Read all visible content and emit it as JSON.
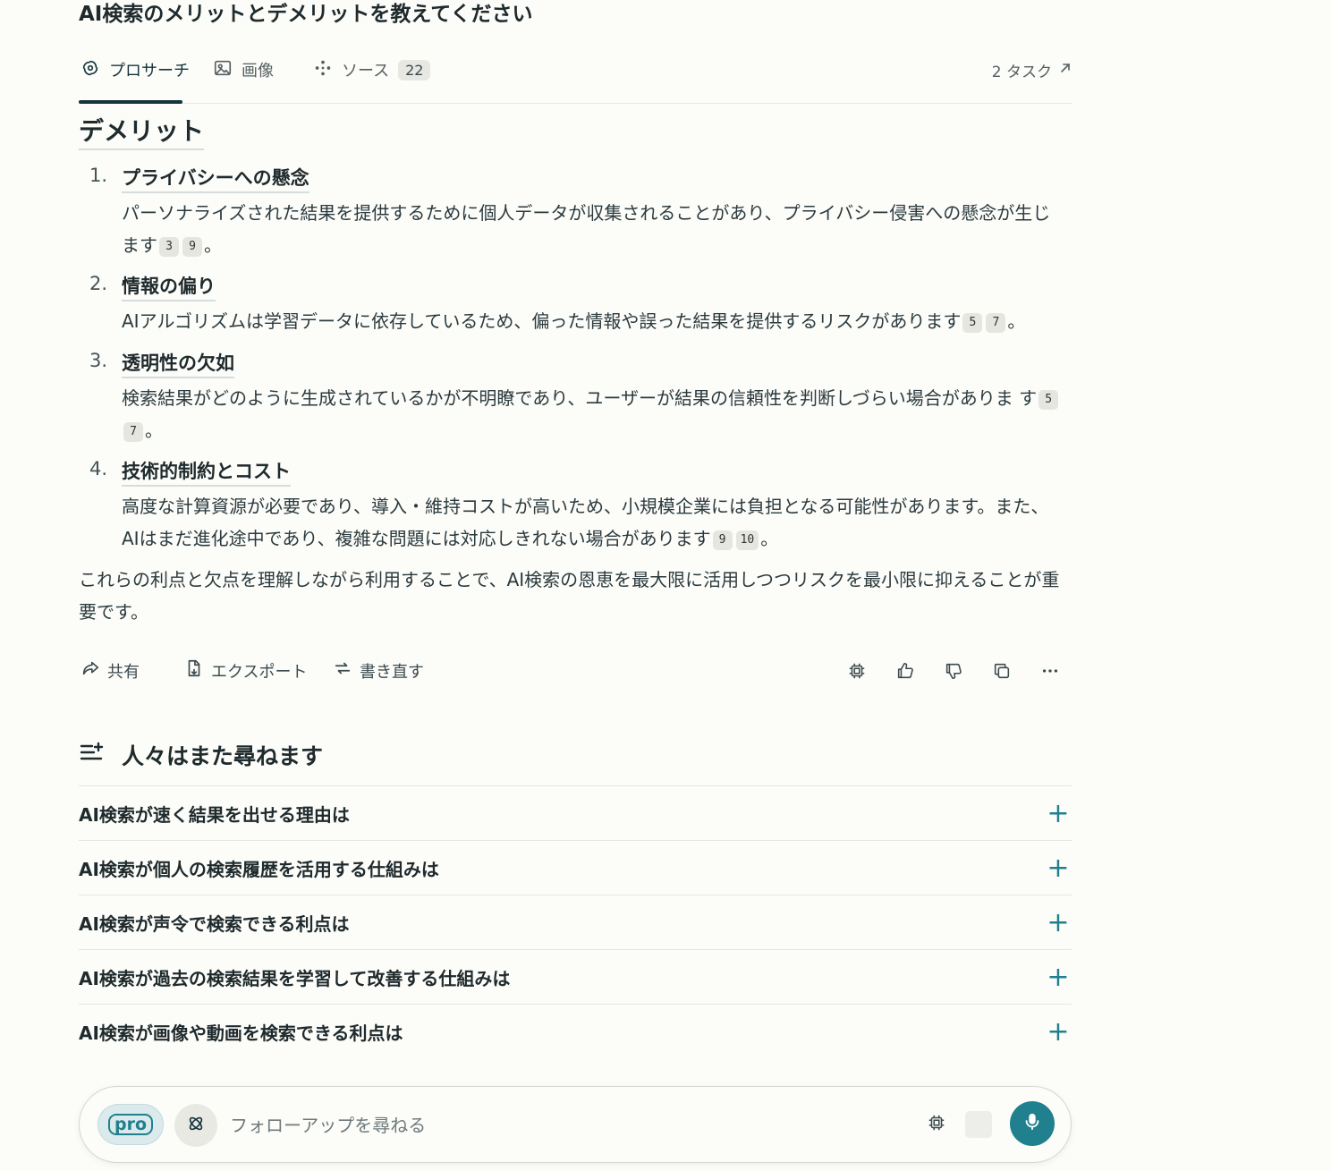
{
  "question": {
    "title": "AI検索のメリットとデメリットを教えてください"
  },
  "tabs": [
    {
      "label": "プロサーチ",
      "icon": "perplexity-swirl-icon",
      "active": true
    },
    {
      "label": "画像",
      "icon": "image-icon"
    },
    {
      "label": "ソース",
      "icon": "sources-icon",
      "count": "22"
    }
  ],
  "tasks": {
    "label": "2 タスク",
    "icon": "arrow-up-right-icon"
  },
  "answer": {
    "section_heading": "デメリット",
    "items": [
      {
        "number": "1.",
        "title": "プライバシーへの懸念",
        "body": "パーソナライズされた結果を提供するために個人データが収集されることがあり、プライバシー侵害への懸念が生じます",
        "citations": [
          "3",
          "9"
        ],
        "end": "。"
      },
      {
        "number": "2.",
        "title": "情報の偏り",
        "body": "AIアルゴリズムは学習データに依存しているため、偏った情報や誤った結果を提供するリスクがあります",
        "citations": [
          "5",
          "7"
        ],
        "end": "。"
      },
      {
        "number": "3.",
        "title": "透明性の欠如",
        "body": "検索結果がどのように生成されているかが不明瞭であり、ユーザーが結果の信頼性を判断しづらい場合がありま す",
        "citations": [
          "5",
          "7"
        ],
        "end": "。"
      },
      {
        "number": "4.",
        "title": "技術的制約とコスト",
        "body": "高度な計算資源が必要であり、導入・維持コストが高いため、小規模企業には負担となる可能性があります。また、AIはまだ進化途中であり、複雑な問題には対応しきれない場合があります",
        "citations": [
          "9",
          "10"
        ],
        "end": "。"
      }
    ],
    "conclusion": "これらの利点と欠点を理解しながら利用することで、AI検索の恩恵を最大限に活用しつつリスクを最小限に抑えることが重要です。"
  },
  "actions": {
    "share": "共有",
    "export": "エクスポート",
    "rewrite": "書き直す"
  },
  "related": {
    "heading": "人々はまた尋ねます",
    "questions": [
      "AI検索が速く結果を出せる理由は",
      "AI検索が個人の検索履歴を活用する仕組みは",
      "AI検索が声令で検索できる利点は",
      "AI検索が過去の検索結果を学習して改善する仕組みは",
      "AI検索が画像や動画を検索できる利点は"
    ]
  },
  "composer": {
    "pro_label": "pro",
    "placeholder": "フォローアップを尋ねる"
  },
  "colors": {
    "accent": "#20808d",
    "text": "#13343b",
    "background": "#fcfcf9"
  }
}
